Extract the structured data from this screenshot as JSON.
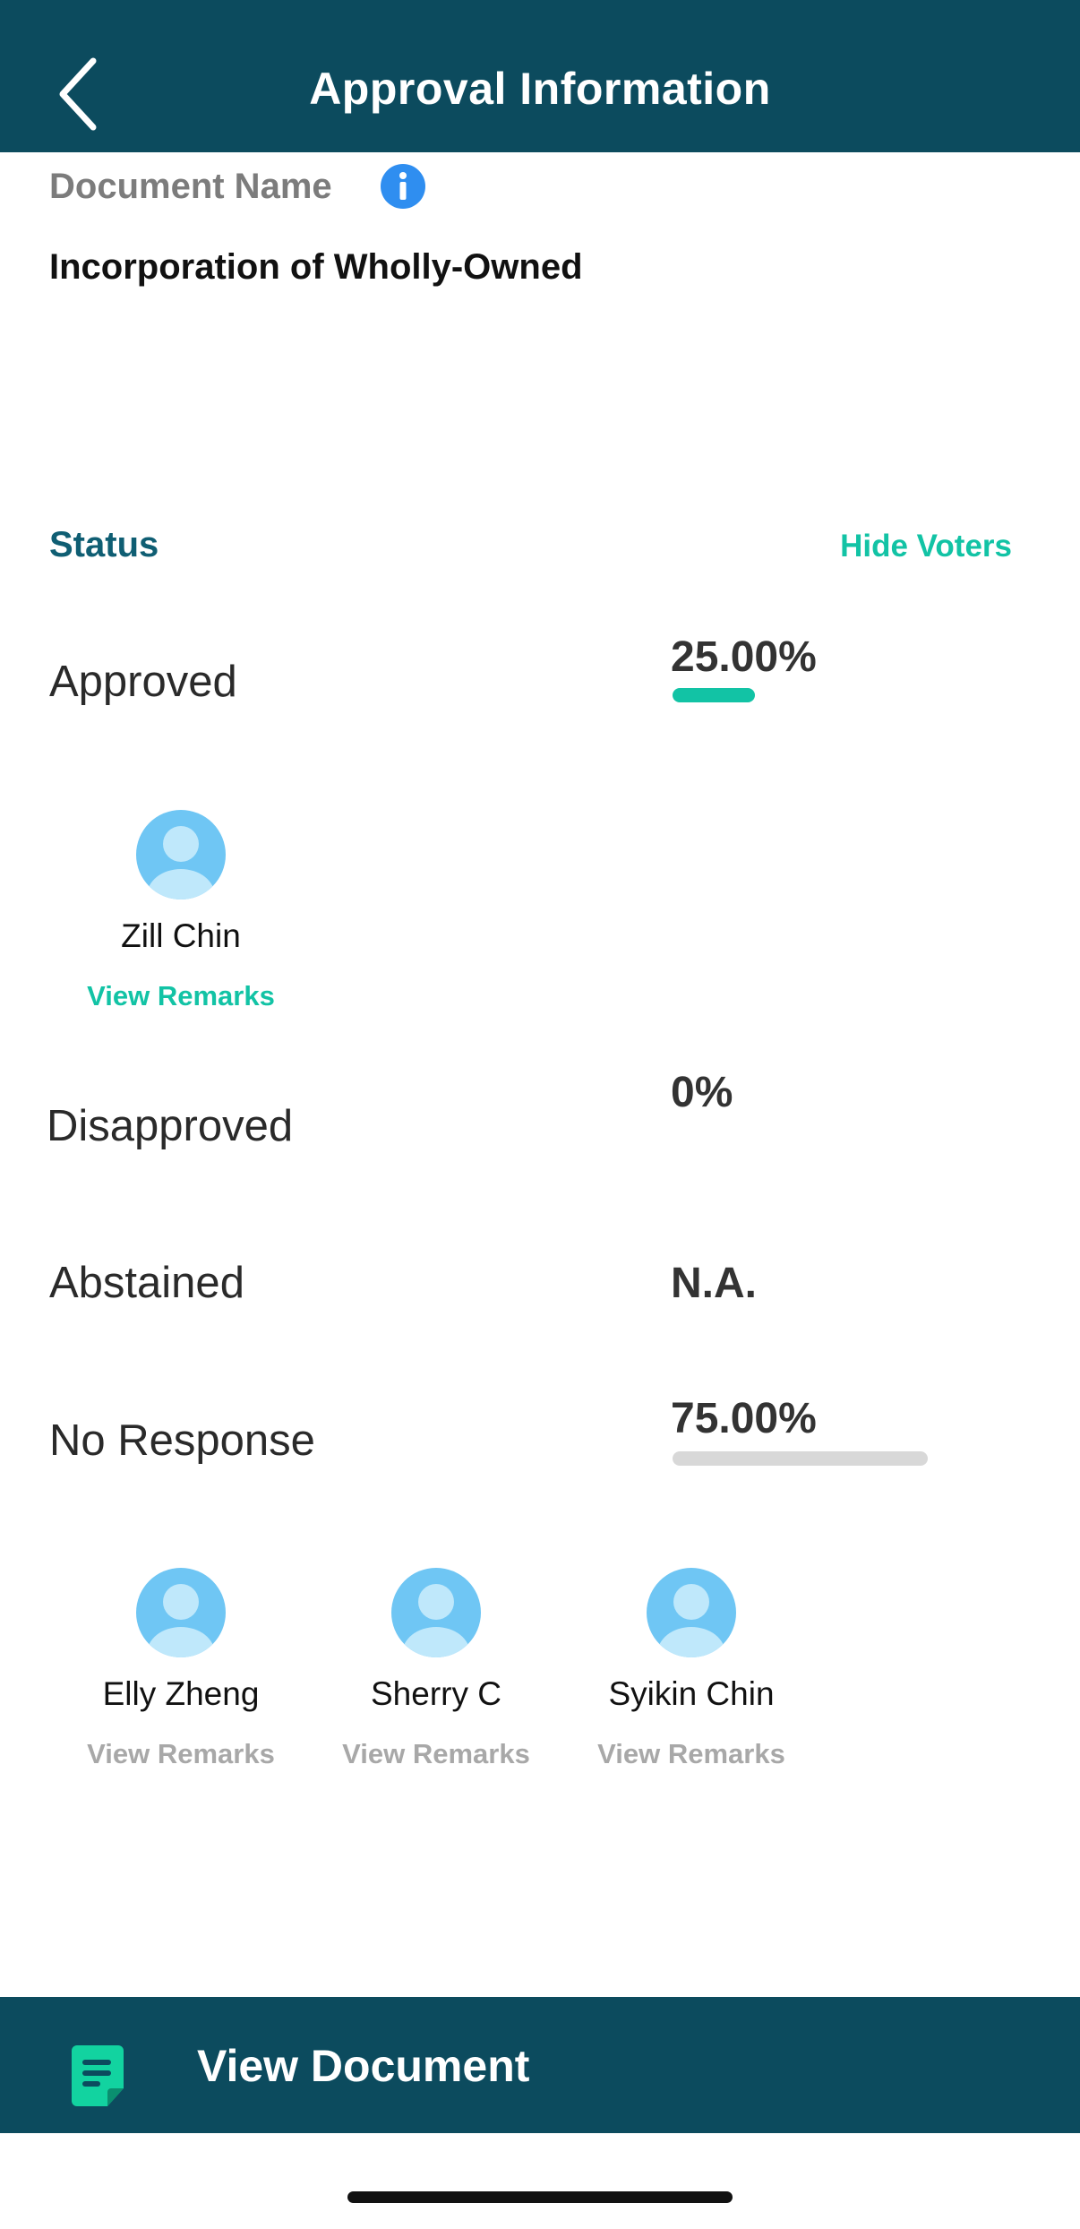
{
  "header": {
    "title": "Approval Information",
    "back_icon": "chevron-left-icon"
  },
  "document": {
    "label": "Document Name",
    "name": "Incorporation of Wholly-Owned",
    "info_icon": "info-icon"
  },
  "status": {
    "label": "Status",
    "toggle_label": "Hide Voters",
    "rows": [
      {
        "label": "Approved",
        "percent_text": "25.00%",
        "fraction": 0.25,
        "bar_color": "#12c3a5",
        "voters": [
          {
            "name": "Zill Chin",
            "remarks": "View Remarks"
          }
        ]
      },
      {
        "label": "Disapproved",
        "percent_text": "0%"
      },
      {
        "label": "Abstained",
        "percent_text": "N.A."
      },
      {
        "label": "No Response",
        "percent_text": "75.00%",
        "fraction": 0.75,
        "bar_color": "#d8d8d8",
        "voters": [
          {
            "name": "Elly Zheng",
            "remarks": "View Remarks"
          },
          {
            "name": "Sherry C",
            "remarks": "View Remarks"
          },
          {
            "name": "Syikin Chin",
            "remarks": "View Remarks"
          }
        ]
      }
    ]
  },
  "footer": {
    "button_label": "View Document",
    "icon": "document-icon"
  },
  "colors": {
    "primary": "#0c4b5e",
    "accent": "#12c3a5",
    "info": "#2f8ef0"
  }
}
